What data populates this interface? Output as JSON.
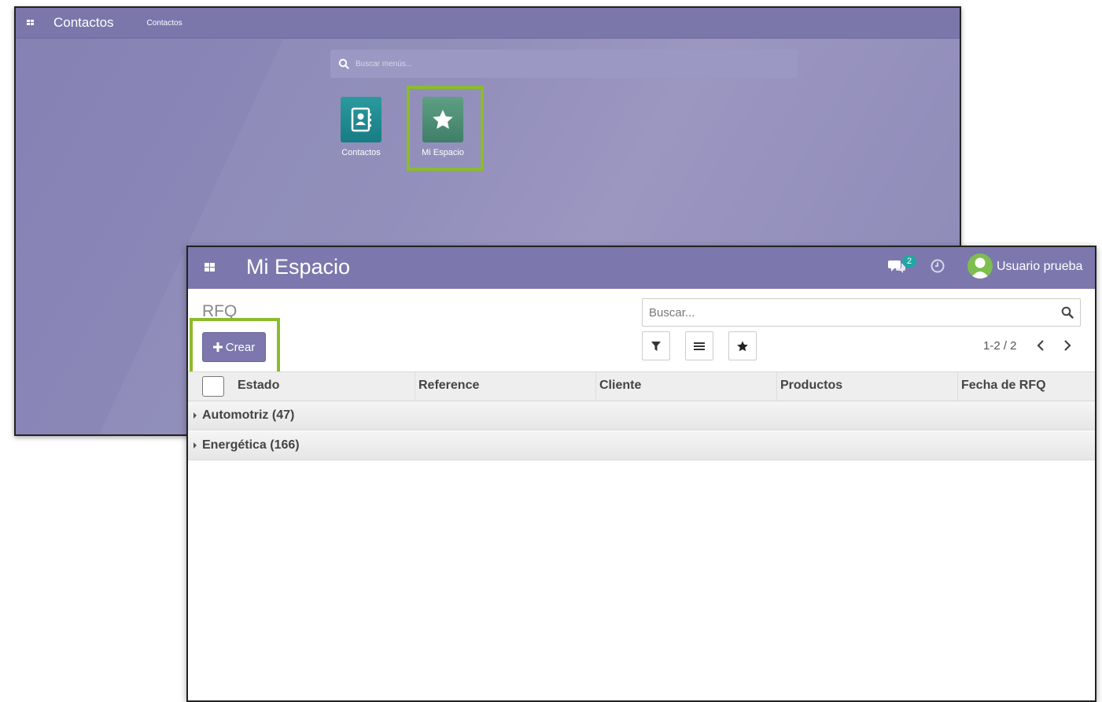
{
  "home": {
    "nav": {
      "title": "Contactos",
      "breadcrumb": "Contactos"
    },
    "search": {
      "placeholder": "Buscar menús..."
    },
    "apps": [
      {
        "label": "Contactos",
        "icon": "address-book-icon"
      },
      {
        "label": "Mi Espacio",
        "icon": "star-icon"
      }
    ]
  },
  "list": {
    "nav": {
      "title": "Mi Espacio",
      "messages_count": "2",
      "user_name": "Usuario prueba"
    },
    "control_panel": {
      "title": "RFQ",
      "create_label": "Crear",
      "search_placeholder": "Buscar...",
      "pager": "1-2 / 2"
    },
    "columns": [
      "Estado",
      "Reference",
      "Cliente",
      "Productos",
      "Fecha de RFQ"
    ],
    "groups": [
      {
        "label": "Automotriz (47)"
      },
      {
        "label": "Energética (166)"
      }
    ]
  },
  "colors": {
    "nav_bg": "#7c78ad",
    "highlight": "#8cbb2c",
    "badge": "#1ea7a3"
  }
}
